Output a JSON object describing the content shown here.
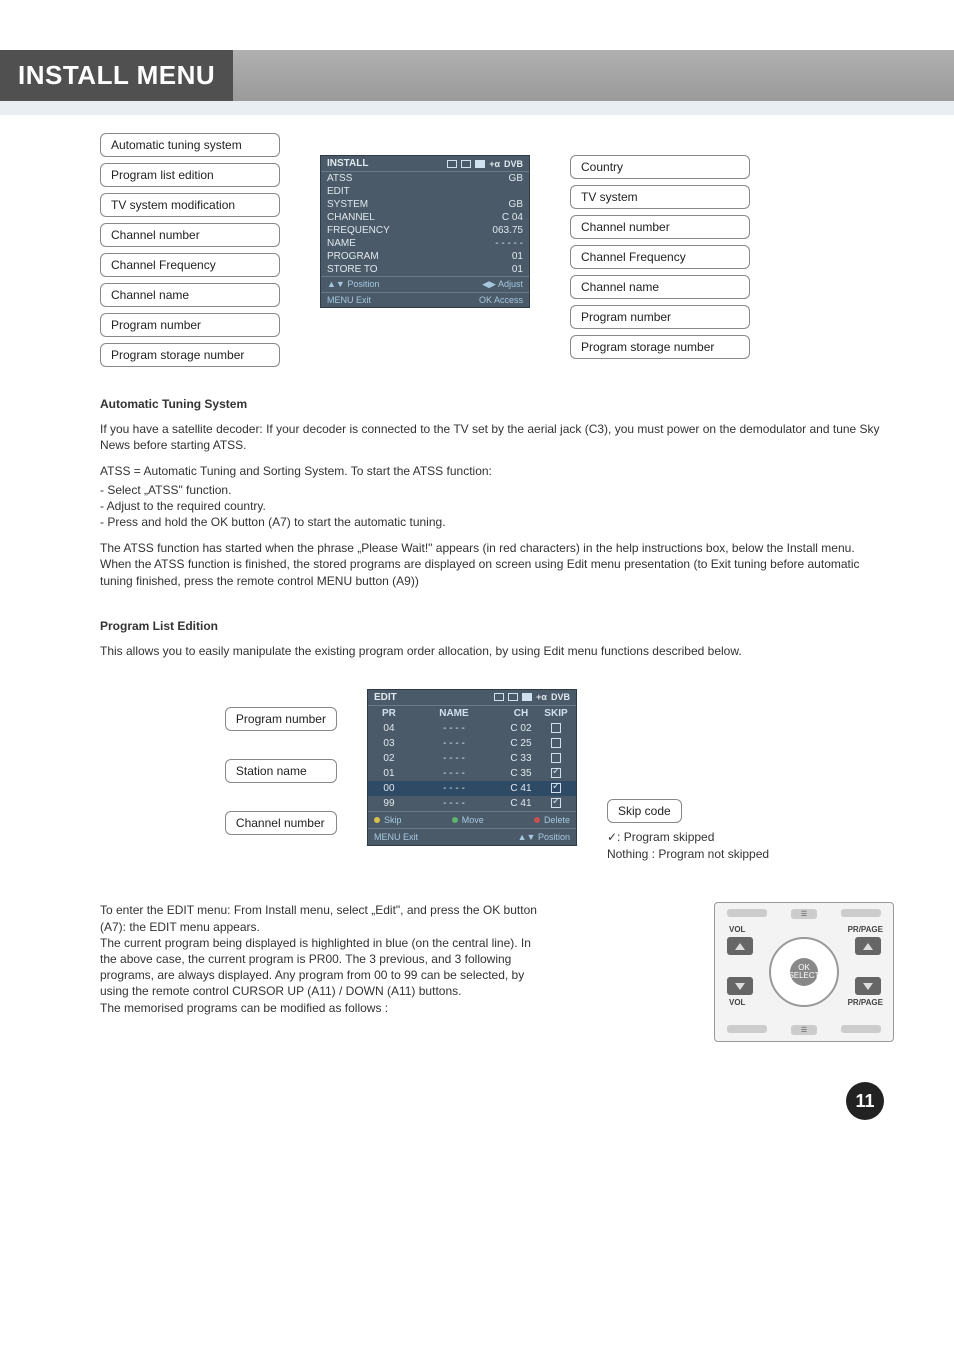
{
  "title": "INSTALL MENU",
  "page_number": "11",
  "diagram1": {
    "left": [
      "Automatic tuning system",
      "Program list edition",
      "TV system modification",
      "Channel number",
      "Channel Frequency",
      "Channel name",
      "Program number",
      "Program storage number"
    ],
    "right": [
      "Country",
      "TV system",
      "Channel number",
      "Channel Frequency",
      "Channel name",
      "Program number",
      "Program storage number"
    ],
    "tv": {
      "header": "INSTALL",
      "rows": [
        {
          "l": "ATSS",
          "r": "GB"
        },
        {
          "l": "EDIT",
          "r": ""
        },
        {
          "l": "SYSTEM",
          "r": "GB"
        },
        {
          "l": "CHANNEL",
          "r": "C 04"
        },
        {
          "l": "FREQUENCY",
          "r": "063.75"
        },
        {
          "l": "NAME",
          "r": "- - - - -"
        },
        {
          "l": "PROGRAM",
          "r": "01"
        },
        {
          "l": "STORE TO",
          "r": "01"
        }
      ],
      "footer": {
        "pos": "▲▼ Position",
        "adj": "◀▶ Adjust",
        "exit": "MENU Exit",
        "ok": "OK  Access"
      }
    }
  },
  "sections": {
    "atss": {
      "head": "Automatic Tuning System",
      "p1": "If you have a satellite decoder: If your decoder is connected to the TV set by the aerial jack (C3), you must power on the demodulator and tune Sky News before starting ATSS.",
      "p2": "ATSS = Automatic Tuning and Sorting System. To start the ATSS function:",
      "b1": "- Select „ATSS\" function.",
      "b2": "- Adjust to the required country.",
      "b3": "- Press and hold the OK button (A7) to start the automatic tuning.",
      "p3": "The ATSS function has started when the phrase „Please Wait!\" appears (in red characters) in the help instructions box, below the Install menu.",
      "p4": "When the ATSS function is finished, the stored programs are displayed on screen using Edit menu presentation (to Exit tuning before automatic tuning finished, press the remote control MENU button (A9))"
    },
    "edit": {
      "head": "Program List Edition",
      "p1": "This allows you to easily manipulate the existing program order allocation, by using Edit menu functions described below."
    }
  },
  "diagram2": {
    "left": [
      "Program number",
      "Station name",
      "Channel number"
    ],
    "skip_label": "Skip code",
    "skip_note1": "✓: Program skipped",
    "skip_note2": "Nothing : Program not skipped",
    "tv": {
      "header": "EDIT",
      "cols": {
        "pr": "PR",
        "name": "NAME",
        "ch": "CH",
        "skip": "SKIP"
      },
      "rows": [
        {
          "pr": "04",
          "name": "- - - -",
          "ch": "C 02",
          "chk": false
        },
        {
          "pr": "03",
          "name": "- - - -",
          "ch": "C 25",
          "chk": false
        },
        {
          "pr": "02",
          "name": "- - - -",
          "ch": "C 33",
          "chk": false
        },
        {
          "pr": "01",
          "name": "- - - -",
          "ch": "C 35",
          "chk": true
        },
        {
          "pr": "00",
          "name": "- - - -",
          "ch": "C 41",
          "chk": true
        },
        {
          "pr": "99",
          "name": "- - - -",
          "ch": "C 41",
          "chk": true
        }
      ],
      "footer": {
        "skip": "Skip",
        "move": "Move",
        "del": "Delete",
        "exit": "MENU Exit",
        "pos": "▲▼ Position"
      }
    }
  },
  "bottom": {
    "p1": "To enter the EDIT menu: From Install menu, select „Edit\", and press the OK button (A7): the EDIT menu appears.",
    "p2": "The current program being displayed is highlighted in blue (on the central line). In the above case, the current program is PR00. The 3 previous, and 3 following programs, are always displayed. Any program from 00 to 99 can be selected, by using the remote control CURSOR UP (A11) / DOWN (A11) buttons.",
    "p3": "The memorised programs can be modified as follows :",
    "remote": {
      "vol": "VOL",
      "prpage": "PR/PAGE",
      "ok": "OK\nSELECT"
    }
  }
}
